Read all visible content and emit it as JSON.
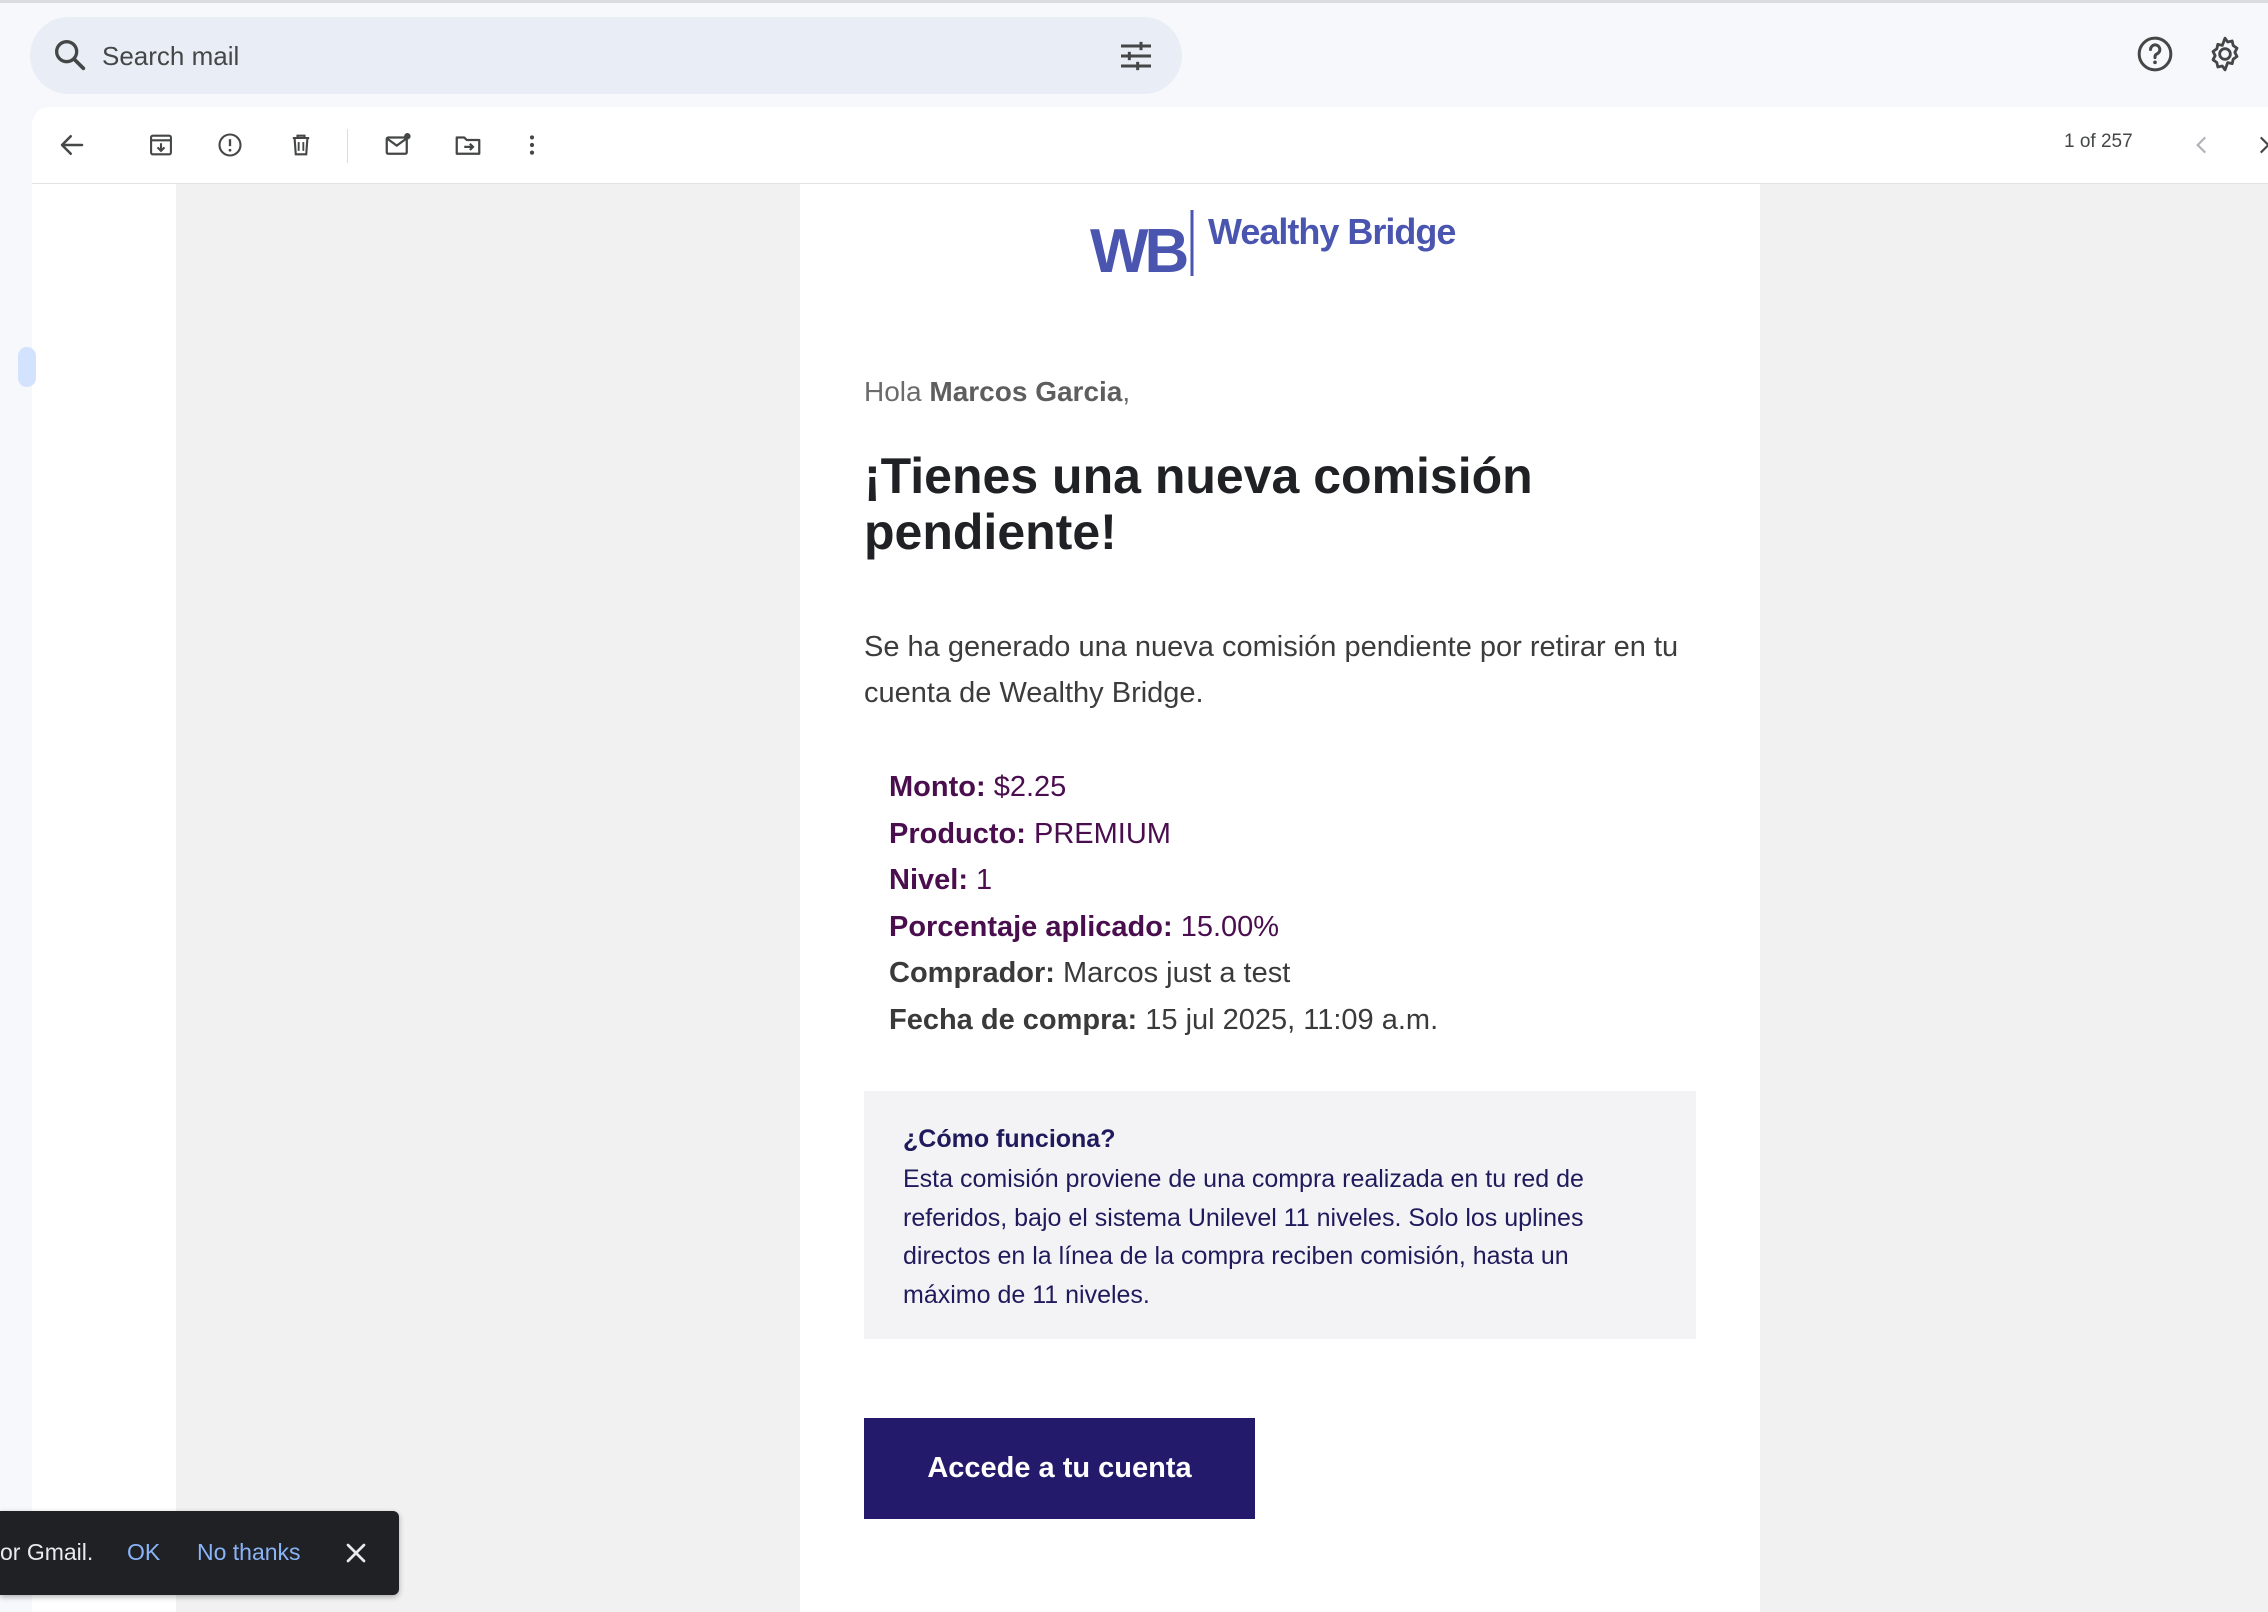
{
  "search": {
    "placeholder": "Search mail"
  },
  "header": {
    "icons": [
      "search-icon",
      "tune-icon",
      "help-icon",
      "settings-icon"
    ]
  },
  "toolbar": {
    "icons": [
      "back-arrow-icon",
      "archive-icon",
      "report-spam-icon",
      "delete-icon",
      "mark-unread-icon",
      "move-to-icon",
      "more-vert-icon",
      "chevron-left-icon",
      "chevron-right-icon"
    ],
    "pager_text": "1 of 257"
  },
  "email": {
    "logo": {
      "mark": "WB",
      "name": "Wealthy Bridge",
      "color": "#4a55b0"
    },
    "greeting_prefix": "Hola ",
    "greeting_name": "Marcos Garcia",
    "greeting_suffix": ",",
    "title": "¡Tienes una nueva comisión pendiente!",
    "lead": "Se ha generado una nueva comisión pendiente por retirar en tu cuenta de Wealthy Bridge.",
    "details": [
      {
        "label": "Monto:",
        "value": "$2.25"
      },
      {
        "label": "Producto:",
        "value": "PREMIUM"
      },
      {
        "label": "Nivel:",
        "value": "1"
      },
      {
        "label": "Porcentaje aplicado:",
        "value": "15.00%"
      },
      {
        "label": "Comprador:",
        "value": "Marcos just a test"
      },
      {
        "label": "Fecha de compra:",
        "value": "15 jul 2025, 11:09 a.m."
      }
    ],
    "info_heading": "¿Cómo funciona?",
    "info_body": "Esta comisión proviene de una compra realizada en tu red de referidos, bajo el sistema Unilevel 11 niveles. Solo los uplines directos en la línea de la compra reciben comisión, hasta un máximo de 11 niveles.",
    "cta_label": "Accede a tu cuenta"
  },
  "snackbar": {
    "message": "or Gmail.",
    "ok_label": "OK",
    "no_label": "No thanks"
  },
  "colors": {
    "accent_dark": "#231a6b",
    "detail_purple": "#4a0e4e",
    "info_text": "#1f1a5c",
    "link_blue": "#8ab4f8"
  }
}
